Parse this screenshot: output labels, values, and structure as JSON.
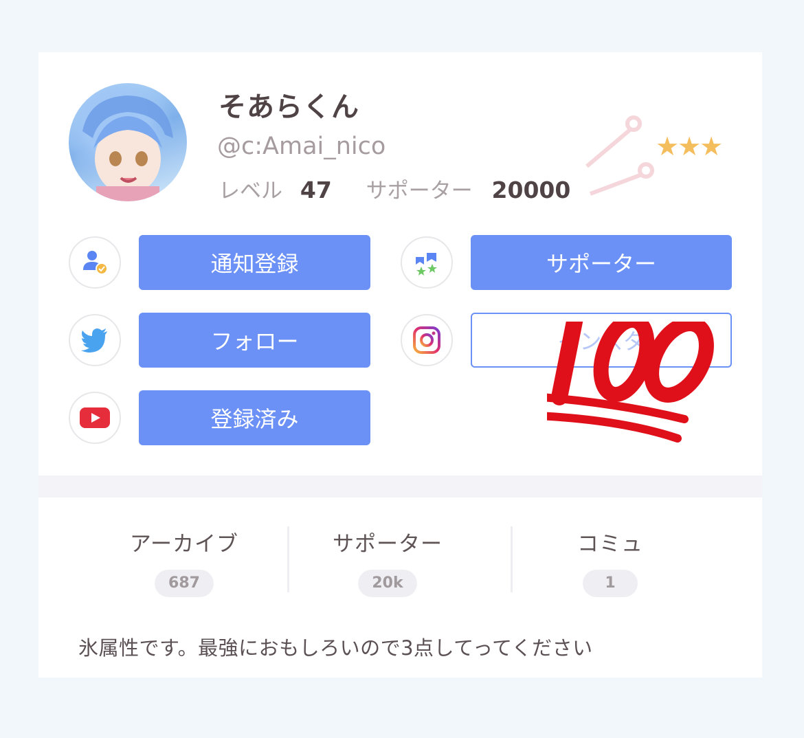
{
  "profile": {
    "name": "そあらくん",
    "handle": "@c:Amai_nico",
    "level_label": "レベル",
    "level_value": "47",
    "supporter_label": "サポーター",
    "supporter_value": "20000",
    "stars": "★★★"
  },
  "actions": {
    "notify": "通知登録",
    "supporter": "サポーター",
    "follow": "フォロー",
    "instagram": "インスタ",
    "subscribed": "登録済み"
  },
  "tabs": [
    {
      "label": "アーカイブ",
      "count": "687"
    },
    {
      "label": "サポーター",
      "count": "20k"
    },
    {
      "label": "コミュ",
      "count": "1"
    }
  ],
  "bio": "氷属性です。最強におもしろいので3点してってください",
  "colors": {
    "button": "#6b91f6",
    "star": "#f4be5e",
    "background": "#f1f7fb",
    "sticker_red": "#e0101a"
  },
  "icons": {
    "notify": "user-check-icon",
    "supporter": "supporter-stars-icon",
    "twitter": "twitter-bird-icon",
    "instagram": "instagram-icon",
    "youtube": "youtube-play-icon",
    "sticker": "hundred-points-emoji"
  }
}
